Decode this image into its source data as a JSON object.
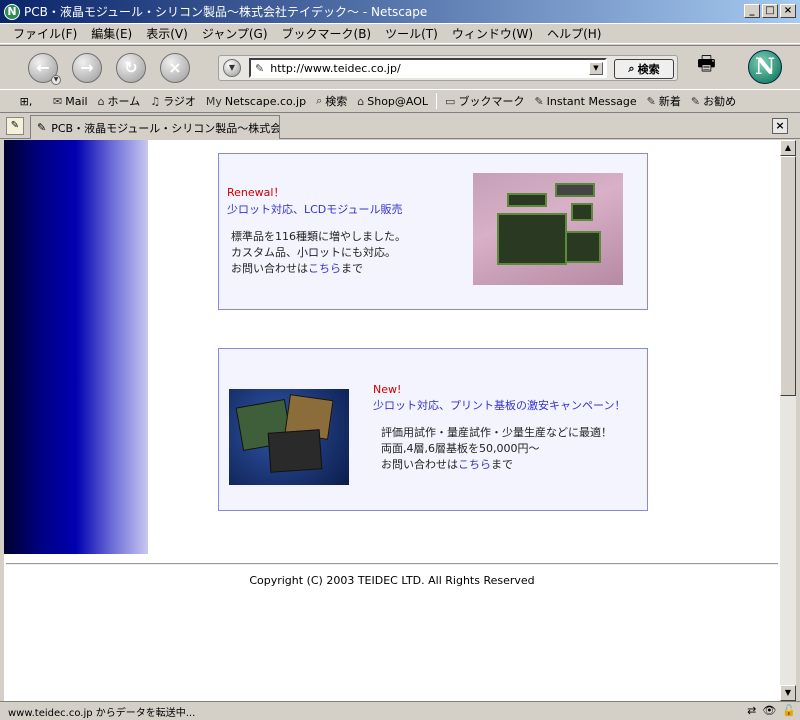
{
  "window": {
    "title": "PCB・液晶モジュール・シリコン製品～株式会社テイデック～ - Netscape",
    "app_icon": "N"
  },
  "menu": [
    "ファイル(F)",
    "編集(E)",
    "表示(V)",
    "ジャンプ(G)",
    "ブックマーク(B)",
    "ツール(T)",
    "ウィンドウ(W)",
    "ヘルプ(H)"
  ],
  "toolbar": {
    "url": "http://www.teidec.co.jp/",
    "search_label": "検索",
    "logo_letter": "N"
  },
  "bookmarks": [
    {
      "label": "Mail",
      "icon": "✉"
    },
    {
      "label": "ホーム",
      "icon": "⌂"
    },
    {
      "label": "ラジオ",
      "icon": "♫"
    },
    {
      "label": "Netscape.co.jp",
      "icon": "My"
    },
    {
      "label": "検索",
      "icon": "⌕"
    },
    {
      "label": "Shop@AOL",
      "icon": "⌂"
    }
  ],
  "bookmarks_right": [
    {
      "label": "ブックマーク",
      "icon": "▭"
    },
    {
      "label": "Instant Message",
      "icon": "✎"
    },
    {
      "label": "新着",
      "icon": "✎"
    },
    {
      "label": "お勧め",
      "icon": "✎"
    }
  ],
  "tab": {
    "label": "PCB・液晶モジュール・シリコン製品～株式会..."
  },
  "promo1": {
    "tag": "Renewal！",
    "headline": "少ロット対応、LCDモジュール販売",
    "line1": "標準品を116種類に増やしました。",
    "line2": "カスタム品、小ロットにも対応。",
    "line3_prefix": "お問い合わせは",
    "line3_link": "こちら",
    "line3_suffix": "まで"
  },
  "promo2": {
    "tag": "New!",
    "headline": "少ロット対応、プリント基板の激安キャンペーン！",
    "line1": "評価用試作・量産試作・少量生産などに最適！",
    "line2": "両面,4層,6層基板を50,000円～",
    "line3_prefix": "お問い合わせは",
    "line3_link": "こちら",
    "line3_suffix": "まで"
  },
  "footer": {
    "copyright": "Copyright (C) 2003 TEIDEC LTD. All Rights Reserved"
  },
  "status": {
    "text": "www.teidec.co.jp からデータを転送中..."
  }
}
